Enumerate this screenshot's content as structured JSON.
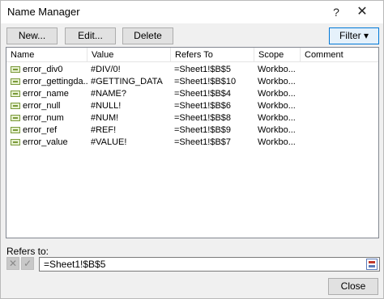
{
  "window": {
    "title": "Name Manager",
    "help_symbol": "?",
    "close_symbol": "✕"
  },
  "toolbar": {
    "new_label": "New...",
    "edit_label": "Edit...",
    "delete_label": "Delete",
    "filter_label": "Filter",
    "filter_arrow": "▾"
  },
  "columns": [
    "Name",
    "Value",
    "Refers To",
    "Scope",
    "Comment"
  ],
  "rows": [
    {
      "name": "error_div0",
      "value": "#DIV/0!",
      "refers_to": "=Sheet1!$B$5",
      "scope": "Workbo..."
    },
    {
      "name": "error_gettingda...",
      "value": "#GETTING_DATA",
      "refers_to": "=Sheet1!$B$10",
      "scope": "Workbo..."
    },
    {
      "name": "error_name",
      "value": "#NAME?",
      "refers_to": "=Sheet1!$B$4",
      "scope": "Workbo..."
    },
    {
      "name": "error_null",
      "value": "#NULL!",
      "refers_to": "=Sheet1!$B$6",
      "scope": "Workbo..."
    },
    {
      "name": "error_num",
      "value": "#NUM!",
      "refers_to": "=Sheet1!$B$8",
      "scope": "Workbo..."
    },
    {
      "name": "error_ref",
      "value": "#REF!",
      "refers_to": "=Sheet1!$B$9",
      "scope": "Workbo..."
    },
    {
      "name": "error_value",
      "value": "#VALUE!",
      "refers_to": "=Sheet1!$B$7",
      "scope": "Workbo..."
    }
  ],
  "refers": {
    "label": "Refers to:",
    "value": "=Sheet1!$B$5",
    "cancel_symbol": "✕",
    "ok_symbol": "✓"
  },
  "footer": {
    "close_label": "Close"
  },
  "icons": {
    "name_row": "defined-name-icon",
    "collapse": "collapse-dialog-icon"
  },
  "colors": {
    "accent": "#0078d7",
    "dialog_bg": "#f0f0f0",
    "list_bg": "#ffffff"
  }
}
